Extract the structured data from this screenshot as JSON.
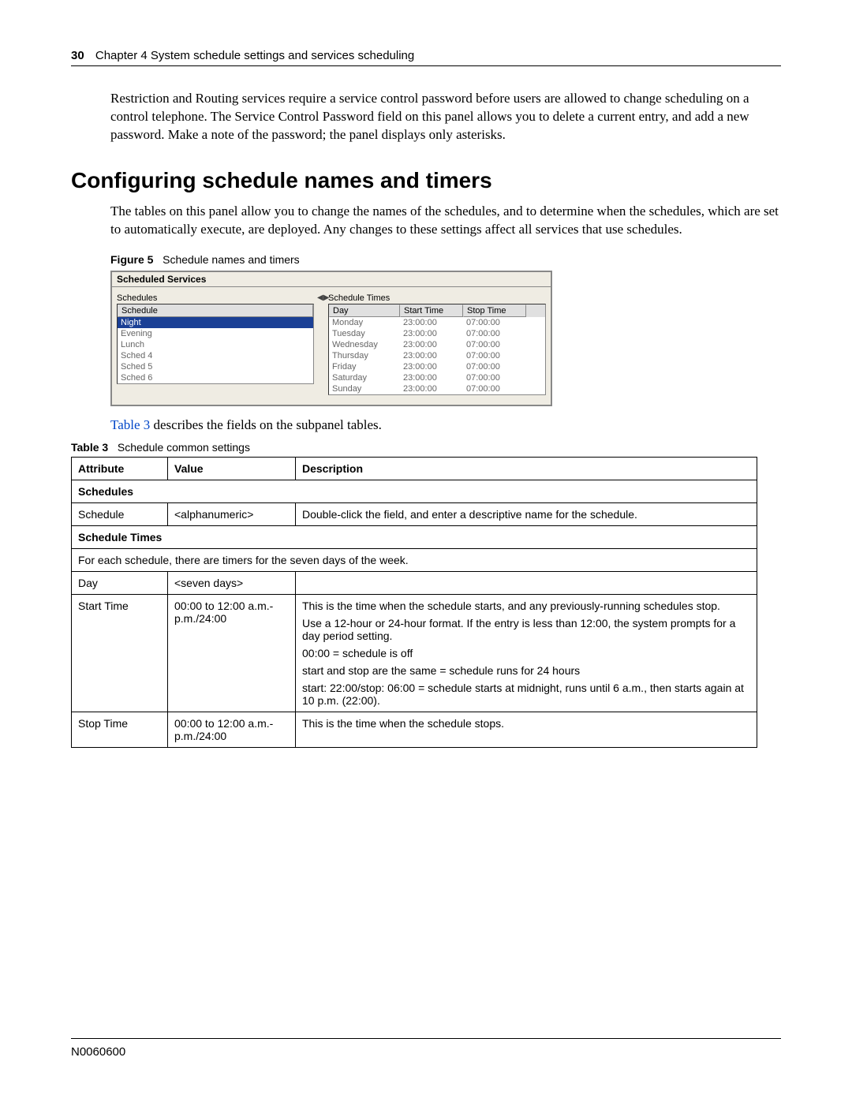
{
  "header": {
    "page_number": "30",
    "chapter_line": "Chapter 4  System schedule settings and services scheduling"
  },
  "intro_paragraph": "Restriction and Routing services require a service control password before users are allowed to change scheduling on a control telephone. The Service Control Password field on this panel allows you to delete a current entry, and add a new password. Make a note of the password; the panel displays only asterisks.",
  "section_heading": "Configuring schedule names and timers",
  "section_paragraph": "The tables on this panel allow you to change the names of the schedules, and to determine when the schedules, which are set to automatically execute, are deployed. Any changes to these settings affect all services that use schedules.",
  "figure": {
    "label_bold": "Figure 5",
    "label_rest": "Schedule names and timers",
    "panel_title": "Scheduled Services",
    "schedules_label": "Schedules",
    "schedules_header": "Schedule",
    "schedules": [
      "Night",
      "Evening",
      "Lunch",
      "Sched 4",
      "Sched 5",
      "Sched 6"
    ],
    "times_label": "Schedule Times",
    "times_headers": {
      "day": "Day",
      "start": "Start Time",
      "stop": "Stop Time"
    },
    "times_rows": [
      {
        "day": "Monday",
        "start": "23:00:00",
        "stop": "07:00:00"
      },
      {
        "day": "Tuesday",
        "start": "23:00:00",
        "stop": "07:00:00"
      },
      {
        "day": "Wednesday",
        "start": "23:00:00",
        "stop": "07:00:00"
      },
      {
        "day": "Thursday",
        "start": "23:00:00",
        "stop": "07:00:00"
      },
      {
        "day": "Friday",
        "start": "23:00:00",
        "stop": "07:00:00"
      },
      {
        "day": "Saturday",
        "start": "23:00:00",
        "stop": "07:00:00"
      },
      {
        "day": "Sunday",
        "start": "23:00:00",
        "stop": "07:00:00"
      }
    ]
  },
  "table3_sentence_pre": "Table 3",
  "table3_sentence_post": " describes the fields on the subpanel tables.",
  "table3": {
    "label_bold": "Table 3",
    "label_rest": "Schedule common settings",
    "columns": {
      "attribute": "Attribute",
      "value": "Value",
      "description": "Description"
    },
    "sections": {
      "schedules_header": "Schedules",
      "schedule_row": {
        "attr": "Schedule",
        "val": "<alphanumeric>",
        "desc": "Double-click the field, and enter a descriptive name for the schedule."
      },
      "times_header": "Schedule Times",
      "times_note": "For each schedule, there are timers for the seven days of the week.",
      "day_row": {
        "attr": "Day",
        "val": "<seven days>",
        "desc": ""
      },
      "start_row": {
        "attr": "Start Time",
        "val": "00:00 to 12:00 a.m.-p.m./24:00",
        "desc_lines": [
          "This is the time when the schedule starts, and any previously-running schedules stop.",
          "Use a 12-hour or 24-hour format. If the entry is less than 12:00, the system prompts for a day period setting.",
          "00:00 = schedule is off",
          "start and stop are the same = schedule runs for 24 hours",
          "start: 22:00/stop: 06:00 = schedule starts at midnight, runs until 6 a.m., then starts again at 10 p.m. (22:00)."
        ]
      },
      "stop_row": {
        "attr": "Stop Time",
        "val": "00:00 to 12:00 a.m.-p.m./24:00",
        "desc": "This is the time when the schedule stops."
      }
    }
  },
  "footer": "N0060600"
}
